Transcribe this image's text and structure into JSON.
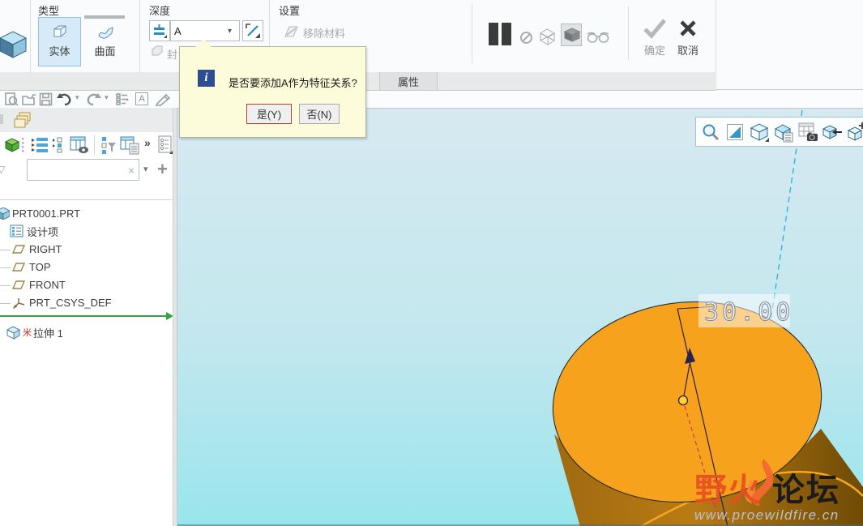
{
  "ribbon": {
    "type_group": {
      "label": "类型",
      "solid_label": "实体",
      "surface_label": "曲面"
    },
    "depth_group": {
      "label": "深度",
      "value": "A",
      "capped_label": "封"
    },
    "settings_group": {
      "label": "设置",
      "remove_material_label": "移除材料"
    },
    "ok_label": "确定",
    "cancel_label": "取消"
  },
  "tab_bar": {
    "properties_tab": "属性"
  },
  "dialog": {
    "info_glyph": "i",
    "message": "是否要添加A作为特征关系?",
    "yes_button": "是(Y)",
    "no_button": "否(N)"
  },
  "navigator": {
    "chevrons": "»"
  },
  "model_tree": {
    "root": "PRT0001.PRT",
    "items": [
      {
        "label": "设计项"
      },
      {
        "label": "RIGHT"
      },
      {
        "label": "TOP"
      },
      {
        "label": "FRONT"
      },
      {
        "label": "PRT_CSYS_DEF"
      }
    ],
    "pending_feature": {
      "marker": "米",
      "label": "拉伸 1"
    }
  },
  "canvas": {
    "dimension_value": "30.00"
  },
  "watermark": {
    "brand": "野火",
    "suffix": "论坛",
    "url": "www.proewildfire.cn"
  },
  "glyphs": {
    "clear": "×",
    "dropdown": "▾",
    "collapse": "▽",
    "add": "+",
    "letter_a": "A",
    "dash": "—"
  },
  "colors": {
    "accent_blue": "#2f8bbf",
    "selection_fill": "#d6ebf7",
    "selection_border": "#8fc6e6",
    "dialog_bg": "#fdfcda",
    "yes_button_border": "#a0453a",
    "canvas_top": "#d7e9f0",
    "canvas_bottom": "#99e5ed",
    "solid_top_face": "#f6a21c",
    "solid_side_dark": "#6e4a05",
    "insert_line_green": "#35a244",
    "dimension_handle_yellow": "#ffd42a",
    "centerline_cyan": "#29b8d8",
    "watermark_red": "#e84e22"
  }
}
